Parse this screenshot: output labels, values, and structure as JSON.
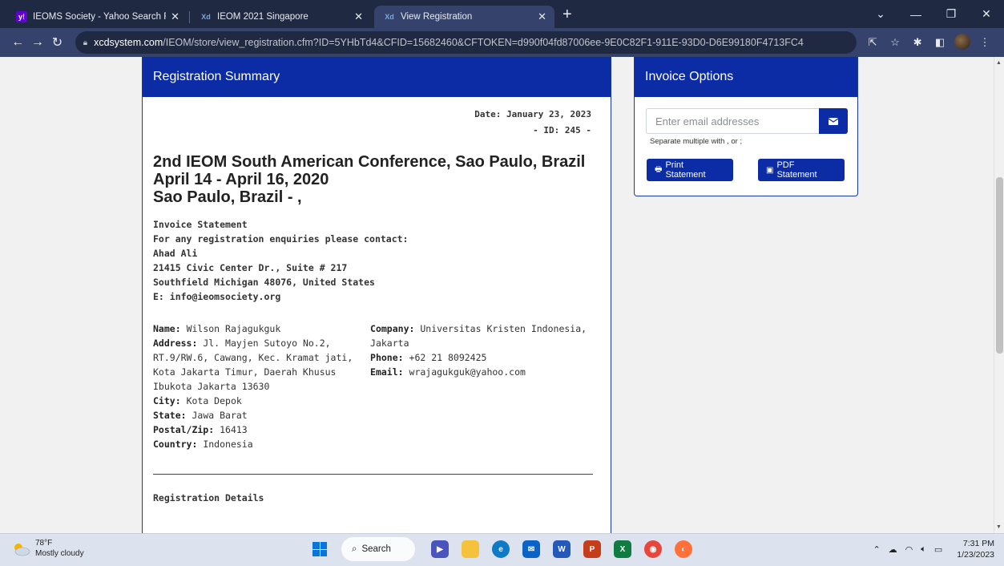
{
  "browser": {
    "tabs": [
      {
        "title": "IEOMS Society - Yahoo Search Re",
        "favicon": "yahoo-icon"
      },
      {
        "title": "IEOM 2021 Singapore",
        "favicon": "xcd-icon"
      },
      {
        "title": "View Registration",
        "favicon": "xcd-icon",
        "active": true
      }
    ],
    "url_host": "xcdsystem.com",
    "url_path": "/IEOM/store/view_registration.cfm?ID=5YHbTd4&CFID=15682460&CFTOKEN=d990f04fd87006ee-9E0C82F1-911E-93D0-D6E99180F4713FC4"
  },
  "summary": {
    "header": "Registration Summary",
    "date": "Date: January 23, 2023",
    "id": "- ID: 245 -",
    "conference": "2nd IEOM South American Conference, Sao Paulo, Brazil",
    "dates": "April 14 - April 16, 2020",
    "location": "Sao Paulo, Brazil - ,",
    "contact_lines": [
      "Invoice Statement",
      "For any registration enquiries please contact:",
      "Ahad Ali",
      "21415 Civic Center Dr., Suite # 217",
      "Southfield Michigan 48076, United States",
      "E: info@ieomsociety.org"
    ],
    "left_fields": [
      {
        "label": "Name:",
        "value": "Wilson Rajagukguk"
      },
      {
        "label": "Address:",
        "value": "Jl. Mayjen Sutoyo No.2, RT.9/RW.6, Cawang, Kec. Kramat jati, Kota Jakarta Timur, Daerah Khusus Ibukota Jakarta 13630"
      },
      {
        "label": "City:",
        "value": "Kota Depok"
      },
      {
        "label": "State:",
        "value": "Jawa Barat"
      },
      {
        "label": "Postal/Zip:",
        "value": "16413"
      },
      {
        "label": "Country:",
        "value": "Indonesia"
      }
    ],
    "right_fields": [
      {
        "label": "Company:",
        "value": "Universitas Kristen Indonesia, Jakarta"
      },
      {
        "label": "Phone:",
        "value": "+62 21 8092425"
      },
      {
        "label": "Email:",
        "value": "wrajagukguk@yahoo.com"
      }
    ],
    "details_heading": "Registration Details"
  },
  "invoice": {
    "header": "Invoice Options",
    "email_placeholder": "Enter email addresses",
    "hint": "Separate multiple with , or ;",
    "print_label": "Print Statement",
    "pdf_label": "PDF Statement"
  },
  "taskbar": {
    "temp": "78°F",
    "weather": "Mostly cloudy",
    "search": "Search",
    "time": "7:31 PM",
    "date": "1/23/2023"
  },
  "colors": {
    "brand": "#0b2ca5",
    "chrome_dark": "#202942",
    "chrome_light": "#35426b"
  }
}
